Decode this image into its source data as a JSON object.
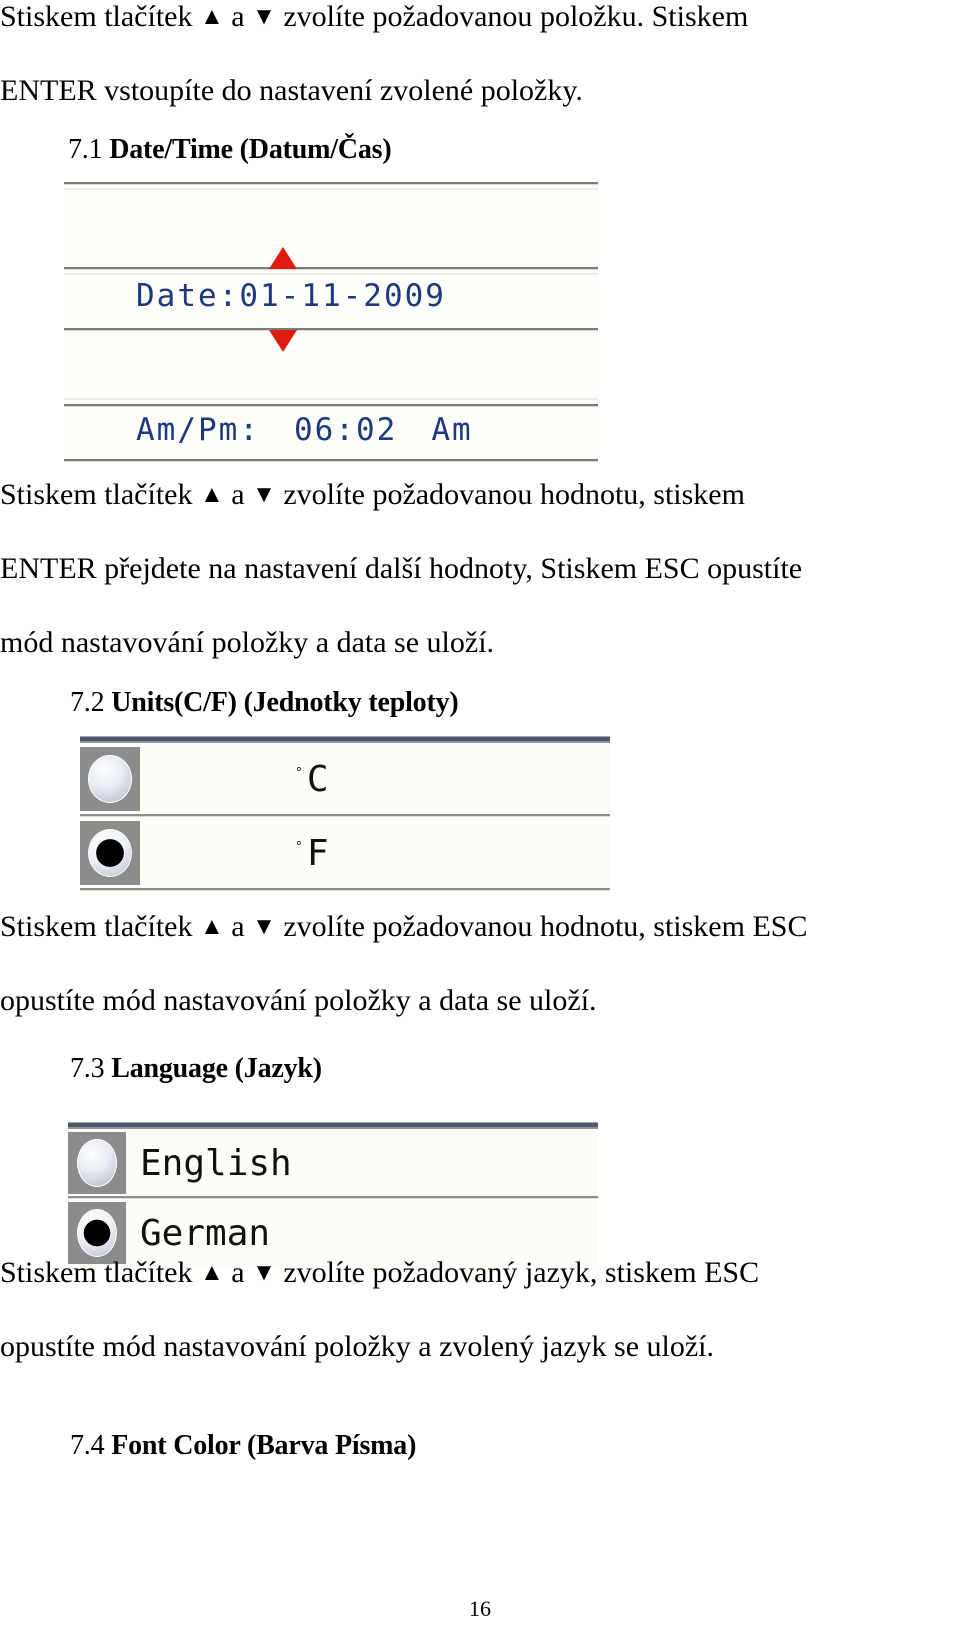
{
  "document": {
    "page_number": "16",
    "language": "cs"
  },
  "intro": {
    "line1_a": "Stiskem",
    "line1_b": "tlačítek",
    "line1_up": "▲",
    "line1_c": "a",
    "line1_down": "▼",
    "line1_d": "zvolíte",
    "line1_e": "požadovanou",
    "line1_f": "položku.",
    "line1_g": "Stiskem",
    "line2": "ENTER vstoupíte do nastavení zvolené položky."
  },
  "section_71": {
    "number": "7.1",
    "title": "Date/Time (Datum/Čas)",
    "lcd": {
      "date_label": "Date:",
      "date_value": "01-11-2009",
      "time_label": "Am/Pm:",
      "time_value": "06:02",
      "meridiem": "Am",
      "arrow_up": "up-arrow",
      "arrow_down": "down-arrow"
    },
    "body": {
      "line1_a": "Stiskem",
      "line1_b": "tlačítek",
      "line1_up": "▲",
      "line1_c": "a",
      "line1_down": "▼",
      "line1_d": "zvolíte",
      "line1_e": "požadovanou",
      "line1_f": "hodnotu,",
      "line1_g": "stiskem",
      "line2": "ENTER přejdete na nastavení další hodnoty, Stiskem ESC opustíte",
      "line3": "mód nastavování položky a data se uloží."
    }
  },
  "section_72": {
    "number": "7.2",
    "title": "Units(C/F) (Jednotky teploty)",
    "lcd": {
      "options": [
        {
          "label": "C",
          "degree": "°",
          "selected": false
        },
        {
          "label": "F",
          "degree": "°",
          "selected": true
        }
      ]
    },
    "body": {
      "line1_a": "Stiskem",
      "line1_b": "tlačítek",
      "line1_up": "▲",
      "line1_c": "a",
      "line1_down": "▼",
      "line1_d": "zvolíte",
      "line1_e": "požadovanou",
      "line1_f": "hodnotu,",
      "line1_g": "stiskem",
      "line1_h": "ESC",
      "line2": "opustíte mód nastavování položky a data se uloží."
    }
  },
  "section_73": {
    "number": "7.3",
    "title": "Language (Jazyk)",
    "lcd": {
      "options": [
        {
          "label": "English",
          "selected": false
        },
        {
          "label": "German",
          "selected": true
        }
      ]
    },
    "body": {
      "line1_a": "Stiskem",
      "line1_b": "tlačítek",
      "line1_up": "▲",
      "line1_c": "a",
      "line1_down": "▼",
      "line1_d": "zvolíte",
      "line1_e": "požadovaný",
      "line1_f": "jazyk,",
      "line1_g": "stiskem",
      "line1_h": "ESC",
      "line2": "opustíte mód nastavování položky a zvolený jazyk se uloží."
    }
  },
  "section_74": {
    "number": "7.4",
    "title": "Font Color (Barva Písma)"
  },
  "colors": {
    "lcd_text": "#1d3a80",
    "arrow_red": "#e01b10",
    "panel_topbar": "#4d5769",
    "rule_gray": "#7b7b7b"
  }
}
